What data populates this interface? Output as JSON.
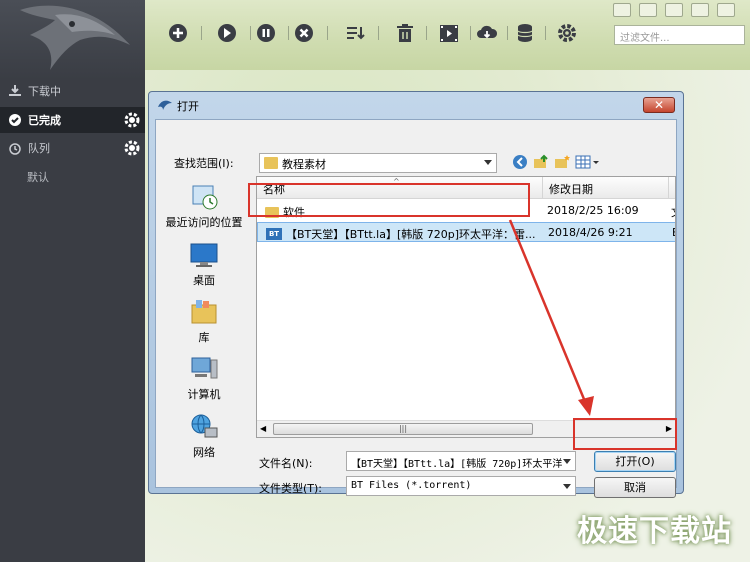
{
  "app": {
    "sidebar": {
      "items": [
        {
          "label": "下载中",
          "icon": "download-icon"
        },
        {
          "label": "已完成",
          "icon": "check-circle-icon",
          "active": true
        },
        {
          "label": "队列",
          "icon": "alarm-clock-icon"
        }
      ],
      "sub_items": [
        "默认"
      ]
    },
    "toolbar": {
      "icons": [
        "add-icon",
        "play-icon",
        "pause-icon",
        "cancel-icon",
        "sort-icon",
        "trash-icon",
        "video-icon",
        "cloud-download-icon",
        "database-icon",
        "gear-icon"
      ]
    },
    "search": {
      "placeholder": "过滤文件..."
    }
  },
  "dialog": {
    "title": "打开",
    "close_label": "✕",
    "look_in_label": "查找范围(I):",
    "look_in_value": "教程素材",
    "places": [
      {
        "label": "最近访问的位置",
        "icon": "recent-places-icon"
      },
      {
        "label": "桌面",
        "icon": "desktop-icon"
      },
      {
        "label": "库",
        "icon": "library-icon"
      },
      {
        "label": "计算机",
        "icon": "computer-icon"
      },
      {
        "label": "网络",
        "icon": "network-icon"
      }
    ],
    "columns": [
      "名称",
      "修改日期",
      "I"
    ],
    "files": [
      {
        "name": "软件",
        "date": "2018/2/25 16:09",
        "extra": "文",
        "type": "folder"
      },
      {
        "name": "【BT天堂】【BTtt.la】[韩版 720p]环太平洋：雷...",
        "date": "2018/4/26 9:21",
        "extra": "E",
        "type": "torrent",
        "selected": true
      }
    ],
    "scroll_thumb": "|||",
    "filename_label": "文件名(N):",
    "filename_value": "【BT天堂】【BTtt.la】[韩版 720p]环太平洋",
    "filetype_label": "文件类型(T):",
    "filetype_value": "BT Files (*.torrent)",
    "open_label": "打开(O)",
    "cancel_label": "取消"
  },
  "watermark": "极速下载站",
  "colors": {
    "highlight": "#d9342b",
    "selection": "#cde6f7"
  }
}
